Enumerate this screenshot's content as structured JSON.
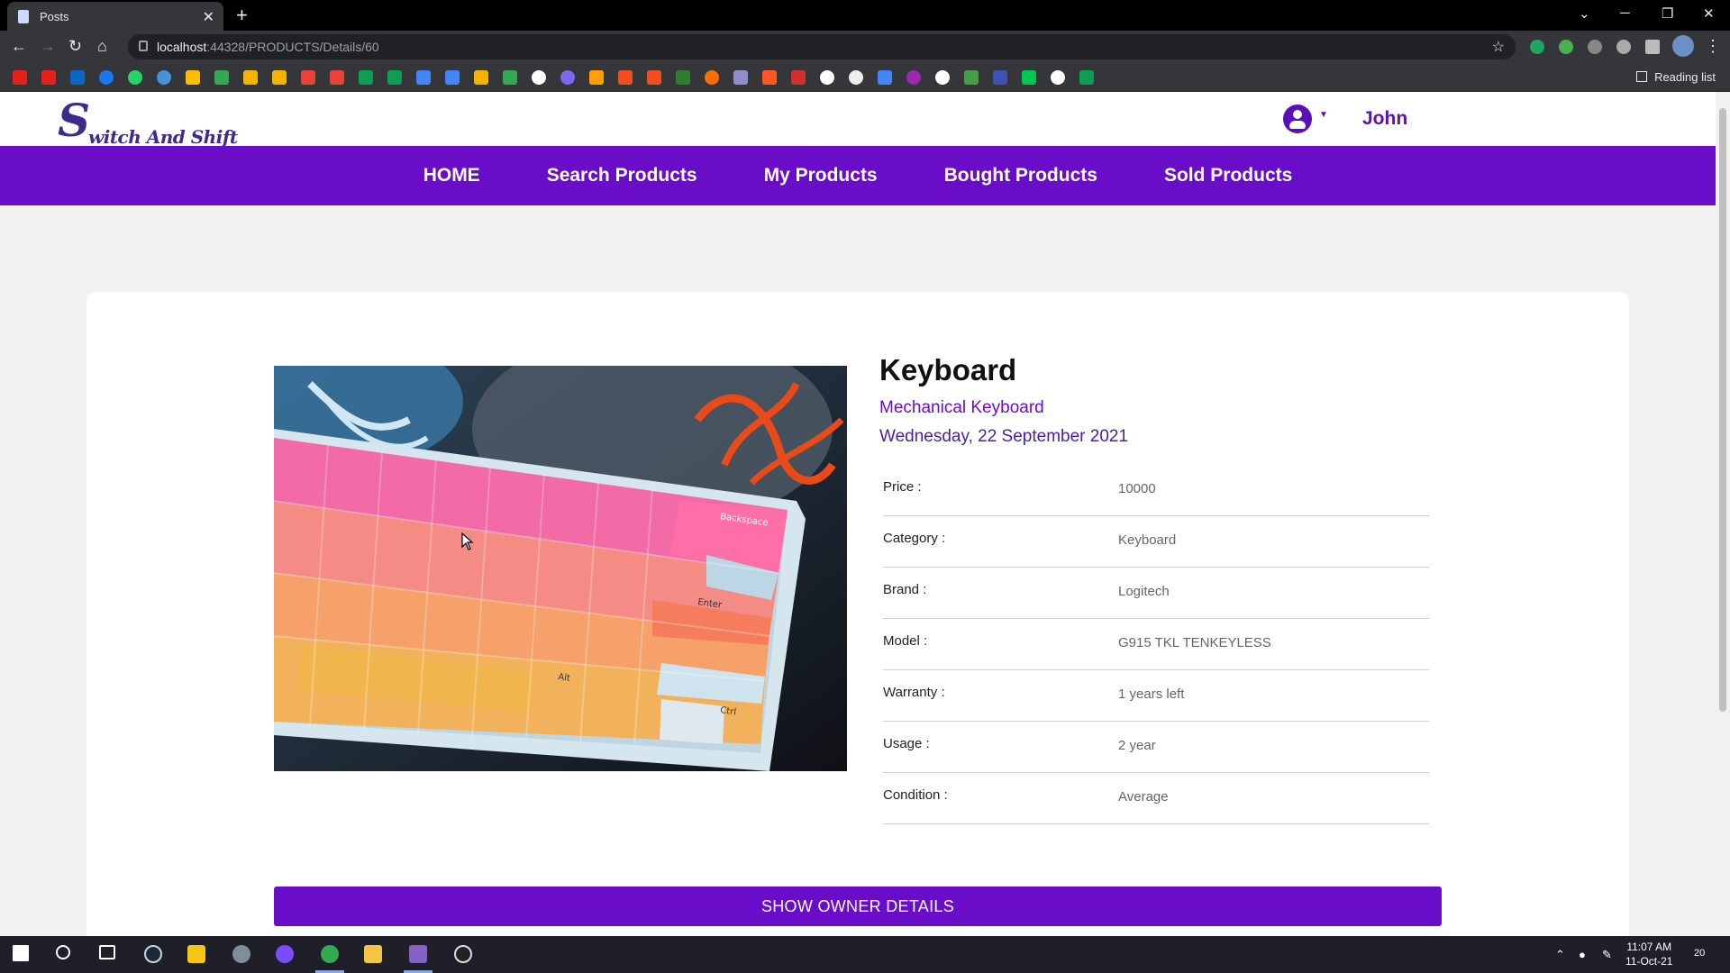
{
  "browser": {
    "tab_title": "Posts",
    "url_host": "localhost",
    "url_path": ":44328/PRODUCTS/Details/60",
    "reading_list": "Reading list"
  },
  "site": {
    "logo_text": "witch And Shift",
    "logo_letter": "S",
    "username": "John",
    "nav": [
      "HOME",
      "Search Products",
      "My Products",
      "Bought Products",
      "Sold Products"
    ]
  },
  "product": {
    "title": "Keyboard",
    "subtitle": "Mechanical Keyboard",
    "date": "Wednesday, 22 September 2021",
    "specs": [
      {
        "label": "Price :",
        "value": "10000"
      },
      {
        "label": "Category :",
        "value": "Keyboard"
      },
      {
        "label": "Brand :",
        "value": "Logitech"
      },
      {
        "label": "Model :",
        "value": "G915 TKL TENKEYLESS"
      },
      {
        "label": "Warranty :",
        "value": "1 years left"
      },
      {
        "label": "Usage :",
        "value": "2 year"
      },
      {
        "label": "Condition :",
        "value": "Average"
      }
    ],
    "owner_button": "SHOW OWNER DETAILS",
    "keycap_legends": [
      "Backspace",
      "Enter",
      "Alt",
      "Ctrl"
    ]
  },
  "taskbar": {
    "time": "11:07 AM",
    "date": "11-Oct-21",
    "notifications": "20"
  },
  "colors": {
    "brand_purple": "#6a0dc9",
    "logo_purple": "#3e2a8c"
  }
}
